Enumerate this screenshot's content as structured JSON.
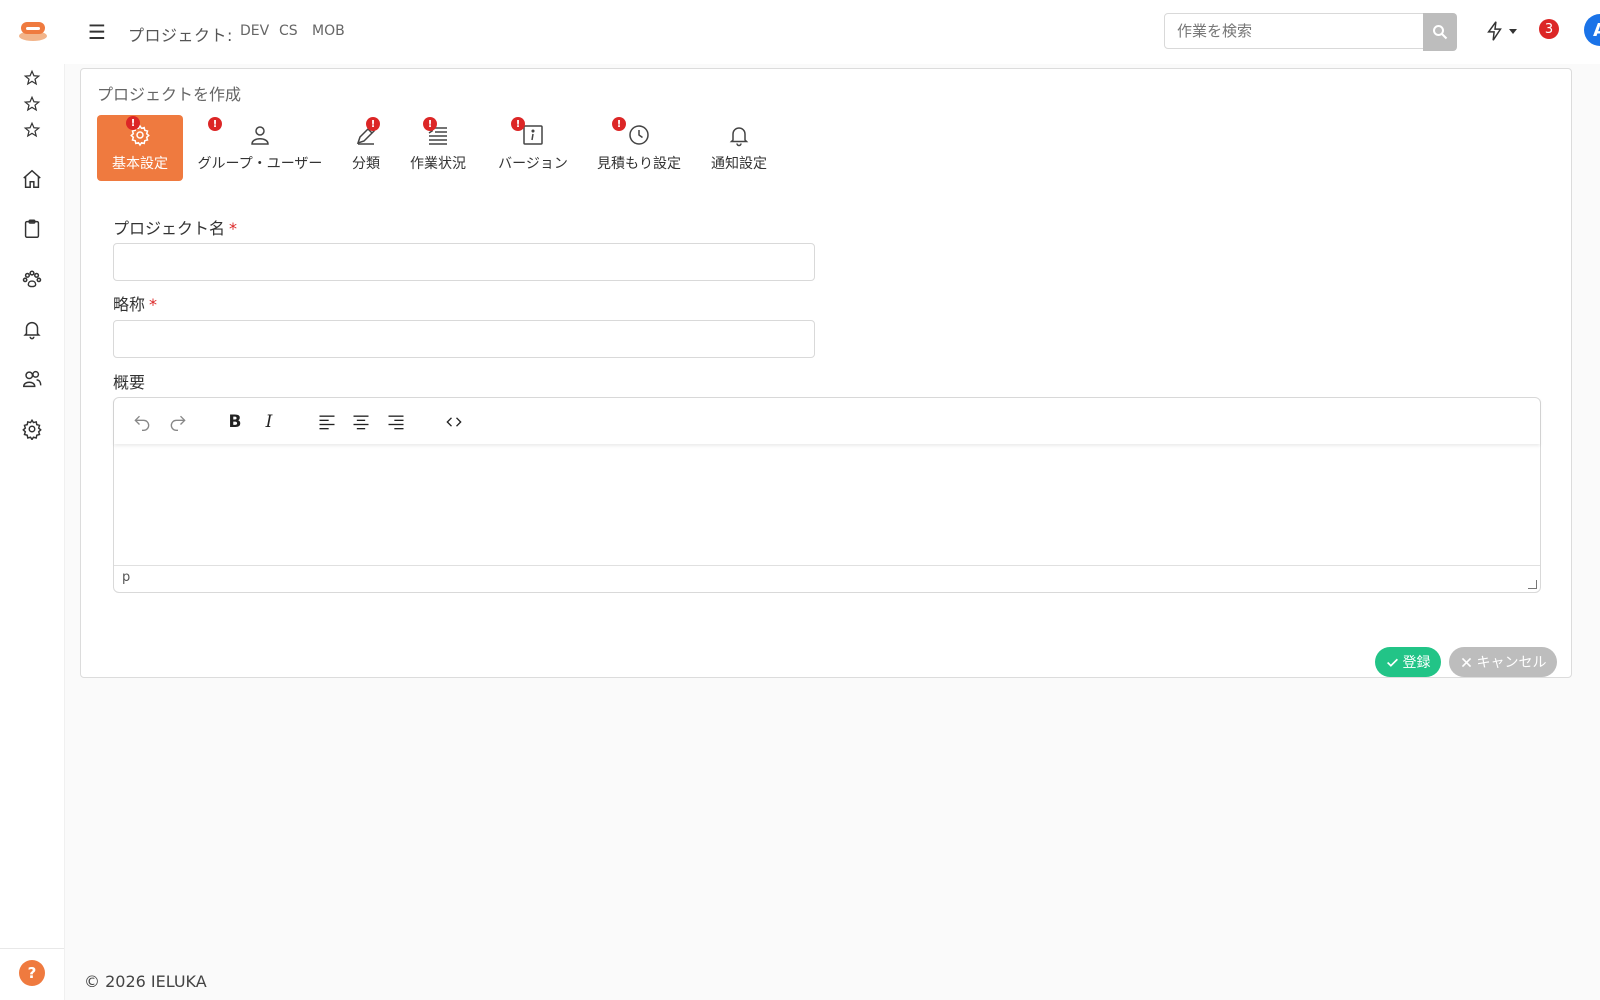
{
  "header": {
    "project_label": "プロジェクト:",
    "project_links": [
      "DEV",
      "CS",
      "MOB"
    ],
    "search_placeholder": "作業を検索",
    "notification_count": "3",
    "avatar_initial": "A"
  },
  "page": {
    "title": "プロジェクトを作成"
  },
  "tabs": [
    {
      "label": "基本設定",
      "icon": "gear-icon",
      "active": true,
      "error": true
    },
    {
      "label": "グループ・ユーザー",
      "icon": "user-icon",
      "active": false,
      "error": true
    },
    {
      "label": "分類",
      "icon": "pen-icon",
      "active": false,
      "error": true
    },
    {
      "label": "作業状況",
      "icon": "list-icon",
      "active": false,
      "error": true
    },
    {
      "label": "バージョン",
      "icon": "info-icon",
      "active": false,
      "error": true
    },
    {
      "label": "見積もり設定",
      "icon": "clock-icon",
      "active": false,
      "error": true
    },
    {
      "label": "通知設定",
      "icon": "bell-icon",
      "active": false,
      "error": false
    }
  ],
  "form": {
    "project_name_label": "プロジェクト名",
    "short_name_label": "略称",
    "summary_label": "概要",
    "required_mark": "*",
    "editor_status_path": "p"
  },
  "actions": {
    "save_label": "登録",
    "cancel_label": "キャンセル"
  },
  "footer": {
    "copyright": "© 2026 IELUKA"
  },
  "colors": {
    "accent": "#ef7a3f",
    "error": "#dc2626",
    "save": "#22c487",
    "avatar": "#1a73e8"
  }
}
